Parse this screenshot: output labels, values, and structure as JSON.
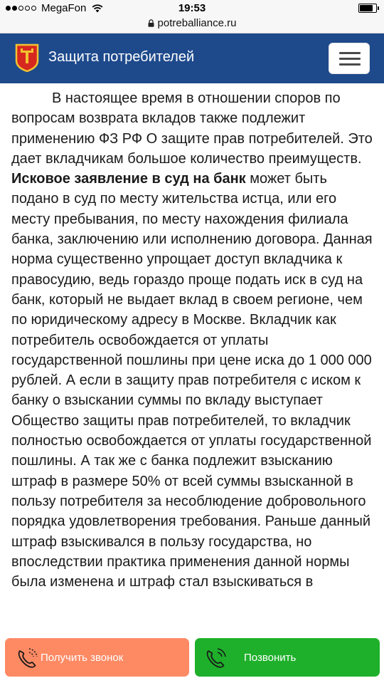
{
  "status_bar": {
    "carrier": "MegaFon",
    "time": "19:53",
    "signal_bars_filled": 2,
    "signal_bars_total": 5,
    "battery_level": 0.9
  },
  "browser": {
    "url": "potreballiance.ru"
  },
  "header": {
    "title": "Защита потребителей",
    "background_color": "#1e4a8c",
    "logo_icon": "coat-of-arms-icon",
    "menu_icon": "hamburger-menu-icon"
  },
  "article": {
    "text_before_bold": "В настоящее время в отношении споров по вопросам возврата вкладов также подлежит применению ФЗ РФ О защите прав потребителей. Это дает вкладчикам большое количество преимуществ. ",
    "bold_text": "Исковое заявление в суд на банк",
    "text_after_bold": " может быть подано в суд по месту жительства истца, или его месту пребывания, по месту нахождения филиала банка, заключению или исполнению договора. Данная норма существенно упрощает доступ вкладчика к правосудию, ведь гораздо проще подать иск в суд на банк, который не выдает вклад в своем регионе, чем по юридическому адресу в Москве. Вкладчик как потребитель освобождается от уплаты государственной пошлины при цене иска до 1 000 000 рублей. А если в защиту прав потребителя с иском к банку о взыскании суммы по вкладу выступает Общество защиты прав потребителей, то вкладчик полностью освобождается от уплаты государственной пошлины. А так же с банка подлежит взысканию штраф в размере 50% от всей суммы взысканной в пользу потребителя за несоблюдение добровольного порядка удовлетворения требования. Раньше данный штраф взыскивался в пользу государства, но впоследствии практика применения данной нормы была изменена и штраф стал взыскиваться в"
  },
  "bottom_bar": {
    "callback": {
      "label": "Получить звонок",
      "color": "#fe8a64",
      "icon": "phone-ringing-icon"
    },
    "call": {
      "label": "Позвонить",
      "color": "#1fb02b",
      "icon": "phone-ringing-icon"
    }
  }
}
